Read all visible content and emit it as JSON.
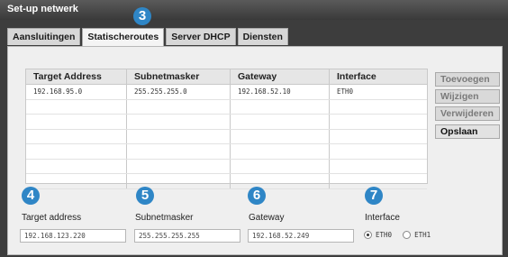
{
  "window": {
    "title": "Set-up netwerk"
  },
  "tabs": [
    {
      "label": "Aansluitingen"
    },
    {
      "label": "Statischeroutes"
    },
    {
      "label": "Server DHCP"
    },
    {
      "label": "Diensten"
    }
  ],
  "badges": [
    "3",
    "4",
    "5",
    "6",
    "7"
  ],
  "table": {
    "columns": [
      "Target Address",
      "Subnetmasker",
      "Gateway",
      "Interface"
    ],
    "rows": [
      [
        "192.168.95.0",
        "255.255.255.0",
        "192.168.52.10",
        "ETH0"
      ],
      [
        "",
        "",
        "",
        ""
      ],
      [
        "",
        "",
        "",
        ""
      ],
      [
        "",
        "",
        "",
        ""
      ],
      [
        "",
        "",
        "",
        ""
      ],
      [
        "",
        "",
        "",
        ""
      ],
      [
        "",
        "",
        "",
        ""
      ]
    ]
  },
  "buttons": {
    "add": "Toevoegen",
    "edit": "Wijzigen",
    "delete": "Verwijderen",
    "save": "Opslaan"
  },
  "form": {
    "target_label": "Target address",
    "target_value": "192.168.123.220",
    "subnet_label": "Subnetmasker",
    "subnet_value": "255.255.255.255",
    "gateway_label": "Gateway",
    "gateway_value": "192.168.52.249",
    "interface_label": "Interface",
    "interface_options": [
      "ETH0",
      "ETH1"
    ],
    "interface_selected": "ETH0"
  },
  "colors": {
    "accent": "#2f86c6",
    "title_bar": "#3d3d3d"
  }
}
